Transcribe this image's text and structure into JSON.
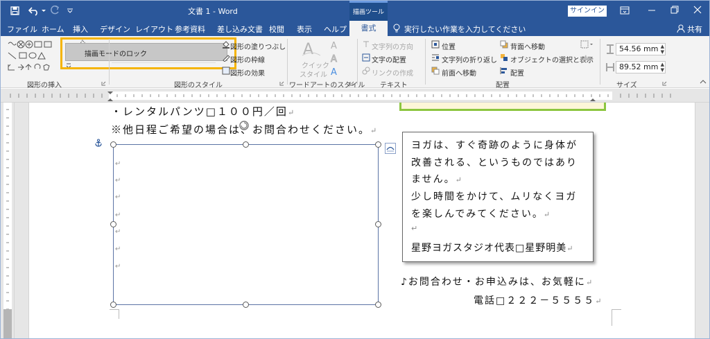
{
  "title": {
    "doc_title": "文書 1 - Word",
    "tools_label": "描画ツール",
    "signin": "サインイン"
  },
  "tabs": [
    "ファイル",
    "ホーム",
    "挿入",
    "デザイン",
    "レイアウト",
    "参考資料",
    "差し込み文書",
    "校閲",
    "表示",
    "ヘルプ",
    "書式"
  ],
  "tell_me": "実行したい作業を入力してください",
  "share": "共有",
  "ribbon": {
    "groups": {
      "insert_shapes": "図形の挿入",
      "shape_styles": "図形のスタイル",
      "wordart_styles": "ワードアートのスタイル",
      "text": "テキスト",
      "arrange": "配置",
      "size": "サイズ"
    },
    "tooltip": "描画モードのロック",
    "fill": "図形の塗りつぶし",
    "outline": "図形の枠線",
    "effects": "図形の効果",
    "quick_style_1": "クイック",
    "quick_style_2": "スタイル",
    "text_direction": "文字列の方向",
    "text_align": "文字の配置",
    "create_link": "リンクの作成",
    "position": "位置",
    "wrap": "文字列の折り返し",
    "bring_forward": "前面へ移動",
    "send_backward": "背面へ移動",
    "selection_pane": "オブジェクトの選択と表示",
    "align": "配置",
    "height": "54.56 mm",
    "width": "89.52 mm"
  },
  "document": {
    "line1": "・レンタルパンツ□１００円／回",
    "line2": "※他日程ご希望の場合は、お問合わせください。",
    "tb_line1": "ヨガは、すぐ奇跡のように身体が",
    "tb_line2": "改善される、というものではあり",
    "tb_line3": "ません。",
    "tb_line4": "少し時間をかけて、ムリなくヨガ",
    "tb_line5": "を楽しんでみてください。",
    "tb_line6": "星野ヨガスタジオ代表□星野明美",
    "contact1": "♪お問合わせ・お申込みは、お気軽に",
    "contact2": "電話□２２２－５５５５"
  },
  "colors": {
    "accent": "#2b579a",
    "highlight": "#f5b400"
  },
  "icons": {
    "save": "save-icon",
    "undo": "undo-icon",
    "redo": "redo-icon",
    "anchor": "anchor-icon",
    "layout_options": "layout-options-icon"
  }
}
